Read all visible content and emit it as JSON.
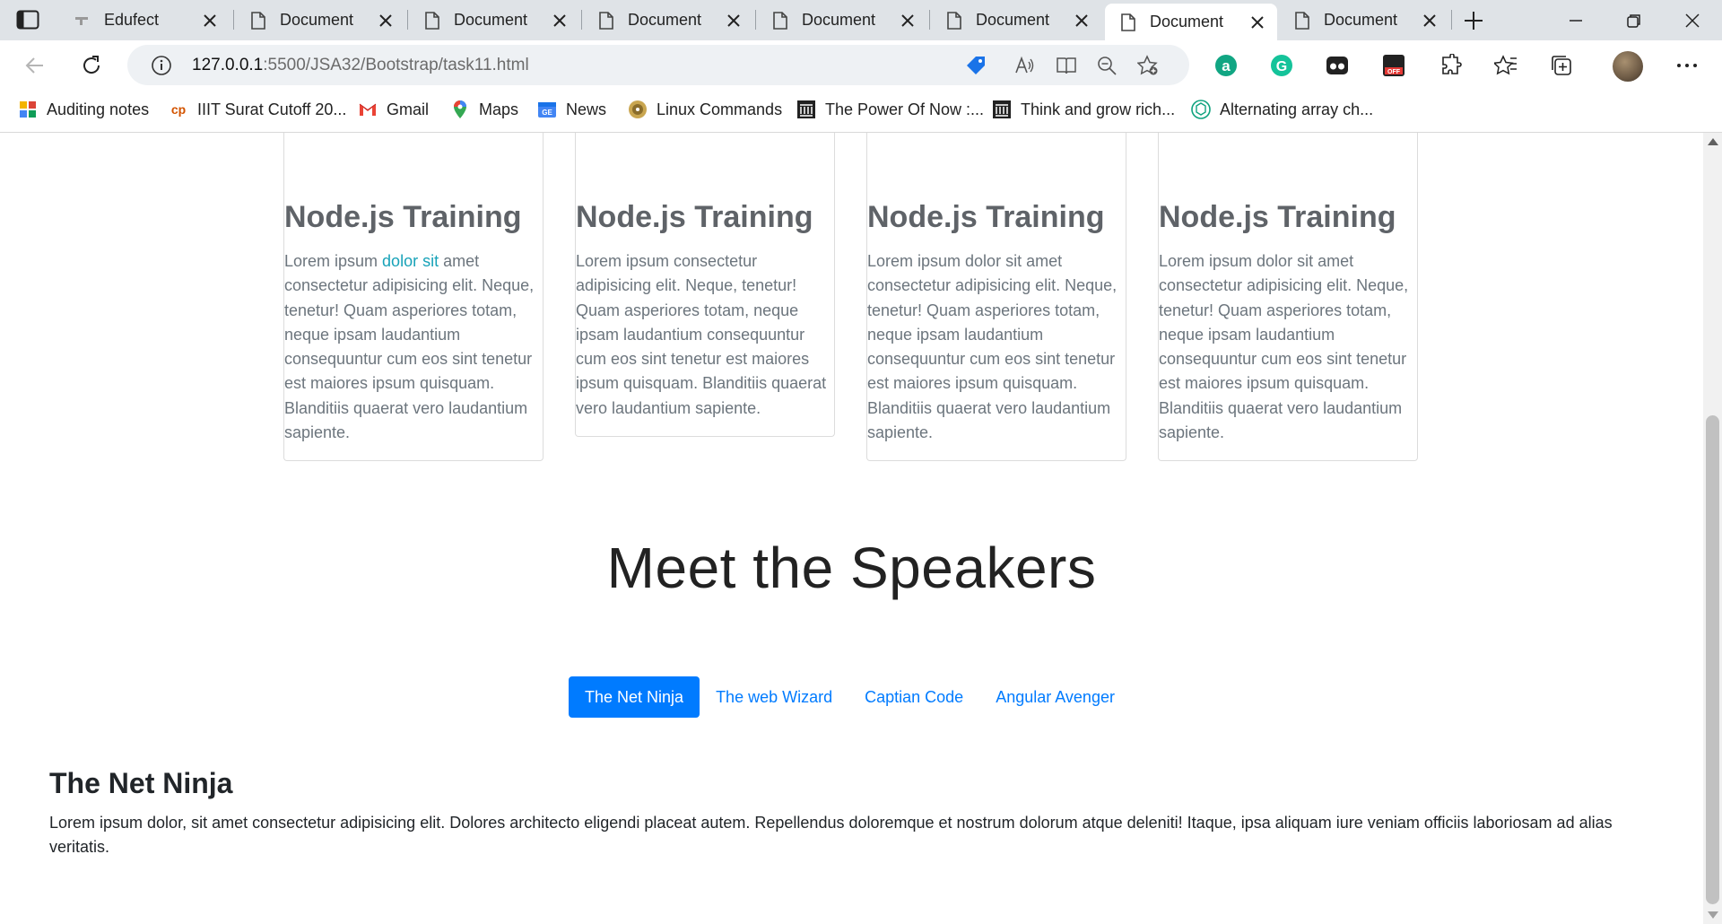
{
  "browser": {
    "tabs": [
      {
        "title": "Edufect",
        "icon": "loading-dash-icon",
        "active": false
      },
      {
        "title": "Document",
        "icon": "page-icon",
        "active": false
      },
      {
        "title": "Document",
        "icon": "page-icon",
        "active": false
      },
      {
        "title": "Document",
        "icon": "page-icon",
        "active": false
      },
      {
        "title": "Document",
        "icon": "page-icon",
        "active": false
      },
      {
        "title": "Document",
        "icon": "page-icon",
        "active": false
      },
      {
        "title": "Document",
        "icon": "page-icon",
        "active": true
      },
      {
        "title": "Document",
        "icon": "page-icon",
        "active": false
      }
    ],
    "address": {
      "host": "127.0.0.1",
      "path": ":5500/JSA32/Bootstrap/task11.html"
    },
    "bookmarks": [
      {
        "label": "Auditing notes",
        "icon": "notes-app-icon"
      },
      {
        "label": "IIIT Surat Cutoff 20...",
        "icon": "cp-icon"
      },
      {
        "label": "Gmail",
        "icon": "gmail-icon"
      },
      {
        "label": "Maps",
        "icon": "maps-pin-icon"
      },
      {
        "label": "News",
        "icon": "news-icon"
      },
      {
        "label": "Linux Commands",
        "icon": "disc-icon"
      },
      {
        "label": "The Power Of Now :...",
        "icon": "library-icon"
      },
      {
        "label": "Think and grow rich...",
        "icon": "library-icon"
      },
      {
        "label": "Alternating array ch...",
        "icon": "chatgpt-icon"
      }
    ]
  },
  "cards": [
    {
      "title": "Node.js Training",
      "text_before": "Lorem ipsum ",
      "link": "dolor sit",
      "text_after": " amet consectetur adipisicing elit. Neque, tenetur! Quam asperiores totam, neque ipsam laudantium consequuntur cum eos sint tenetur est maiores ipsum quisquam. Blanditiis quaerat vero laudantium sapiente."
    },
    {
      "title": "Node.js Training",
      "text_before": "Lorem ipsum consectetur adipisicing elit. Neque, tenetur! Quam asperiores totam, neque ipsam laudantium consequuntur cum eos sint tenetur est maiores ipsum quisquam. Blanditiis quaerat vero laudantium sapiente.",
      "link": "",
      "text_after": ""
    },
    {
      "title": "Node.js Training",
      "text_before": "Lorem ipsum dolor sit amet consectetur adipisicing elit. Neque, tenetur! Quam asperiores totam, neque ipsam laudantium consequuntur cum eos sint tenetur est maiores ipsum quisquam. Blanditiis quaerat vero laudantium sapiente.",
      "link": "",
      "text_after": ""
    },
    {
      "title": "Node.js Training",
      "text_before": "Lorem ipsum dolor sit amet consectetur adipisicing elit. Neque, tenetur! Quam asperiores totam, neque ipsam laudantium consequuntur cum eos sint tenetur est maiores ipsum quisquam. Blanditiis quaerat vero laudantium sapiente.",
      "link": "",
      "text_after": ""
    }
  ],
  "speakers": {
    "heading": "Meet the Speakers",
    "pills": [
      "The Net Ninja",
      "The web Wizard",
      "Captian Code",
      "Angular Avenger"
    ],
    "active_pill": 0,
    "pane": {
      "title": "The Net Ninja",
      "text": "Lorem ipsum dolor, sit amet consectetur adipisicing elit. Dolores architecto eligendi placeat autem. Repellendus doloremque et nostrum dolorum atque deleniti! Itaque, ipsa aliquam iure veniam officiis laboriosam ad alias veritatis."
    }
  },
  "colors": {
    "primary": "#007bff",
    "link": "#17a2b8",
    "muted_text": "#6c757d"
  }
}
